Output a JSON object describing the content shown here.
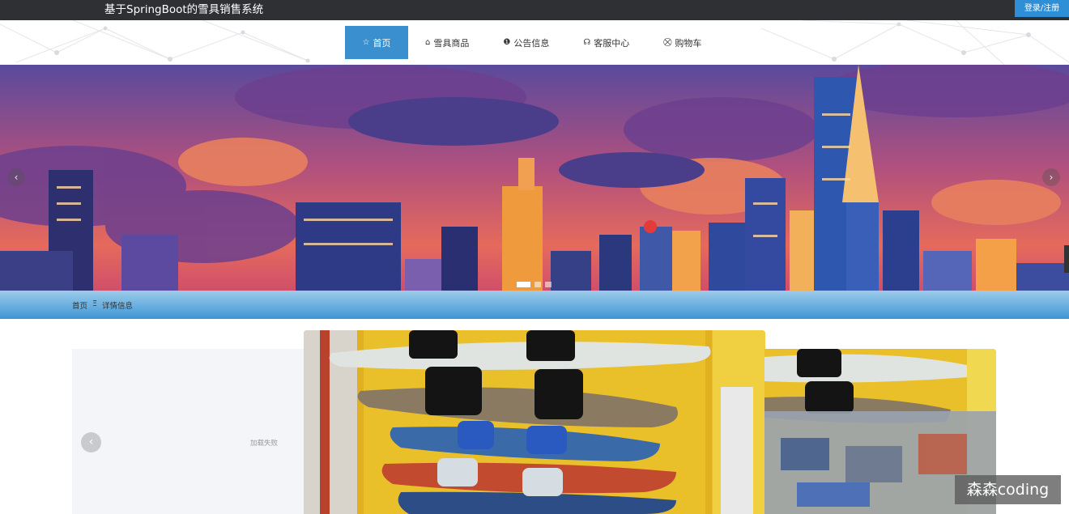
{
  "header": {
    "site_title": "基于SpringBoot的雪具销售系统",
    "login_label": "登录/注册"
  },
  "nav": {
    "items": [
      {
        "label": "首页",
        "icon": "star-icon",
        "active": true
      },
      {
        "label": "雪具商品",
        "icon": "bag-icon",
        "active": false
      },
      {
        "label": "公告信息",
        "icon": "info-icon",
        "active": false
      },
      {
        "label": "客服中心",
        "icon": "headset-icon",
        "active": false
      },
      {
        "label": "购物车",
        "icon": "cart-icon",
        "active": false
      }
    ]
  },
  "banner": {
    "prev_icon": "chevron-left-icon",
    "next_icon": "chevron-right-icon",
    "slide_count": 3,
    "active_slide": 1
  },
  "breadcrumb": {
    "home": "首页",
    "separator": "Ξ",
    "current": "详情信息"
  },
  "detail": {
    "gallery_prev_icon": "chevron-left-icon",
    "load_failed_text": "加载失败"
  },
  "watermark": "森森coding",
  "colors": {
    "topbar": "#2f3034",
    "accent": "#3a8fce",
    "login": "#2f8fd6"
  }
}
